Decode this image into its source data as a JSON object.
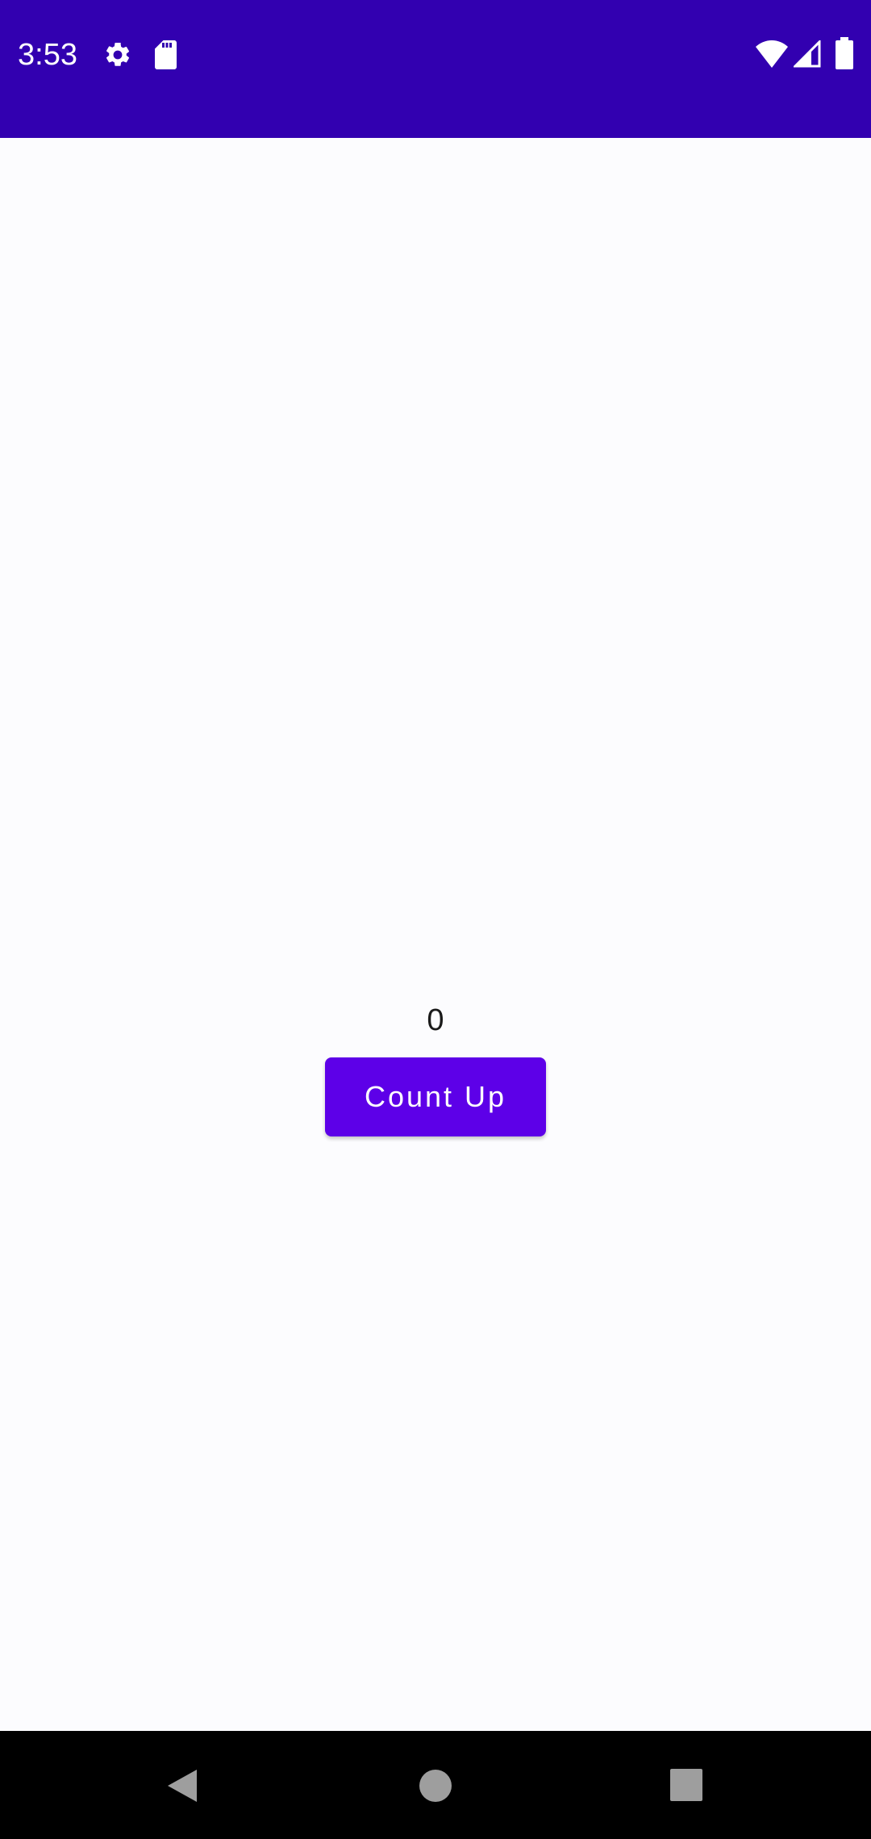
{
  "status_bar": {
    "time": "3:53",
    "background_color": "#3200b0",
    "icons": [
      "gear-icon",
      "sd-card-icon",
      "wifi-icon",
      "signal-icon",
      "battery-icon"
    ]
  },
  "main": {
    "counter_value": "0",
    "count_up_label": "Count Up",
    "accent_color": "#5d00e8"
  },
  "nav_bar": {
    "icons": [
      "back-icon",
      "home-icon",
      "recents-icon"
    ]
  }
}
